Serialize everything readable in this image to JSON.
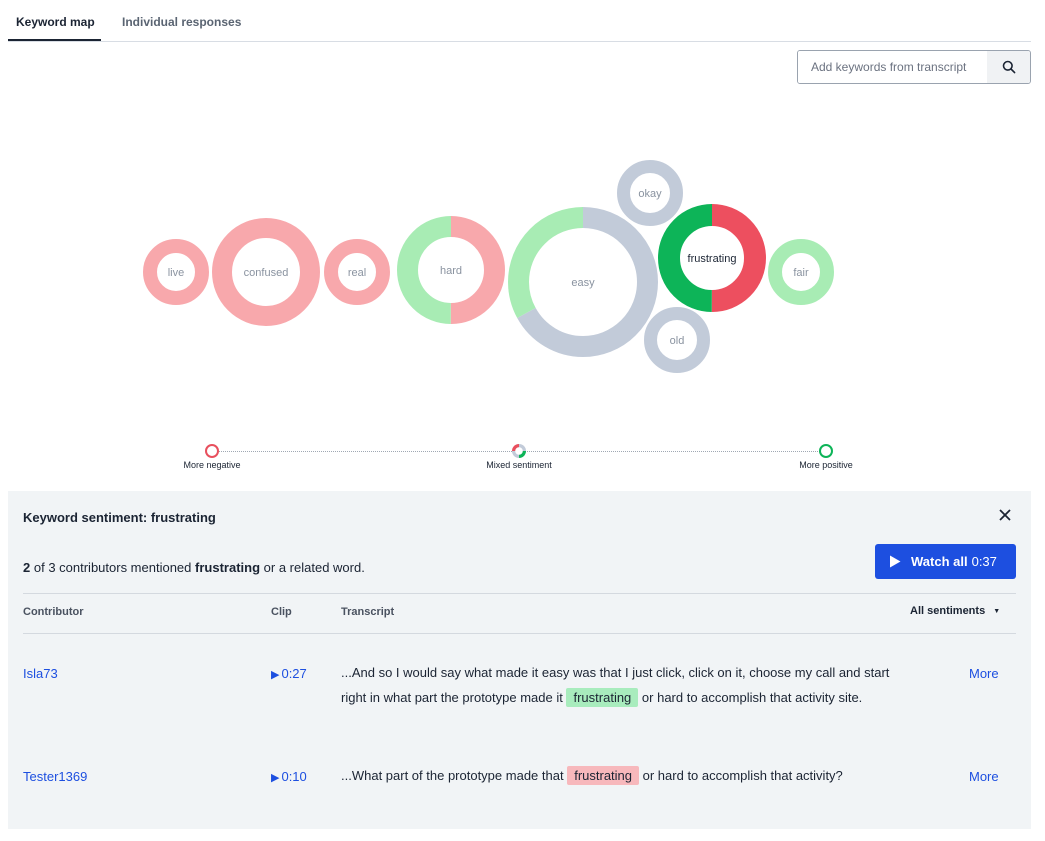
{
  "tabs": [
    {
      "label": "Keyword map",
      "active": true
    },
    {
      "label": "Individual responses",
      "active": false
    }
  ],
  "search": {
    "placeholder": "Add keywords from transcript",
    "icon": "search-icon"
  },
  "bubbles": [
    {
      "word": "live",
      "segments": [
        {
          "color": "#f8a8ac",
          "frac": 1
        }
      ]
    },
    {
      "word": "confused",
      "segments": [
        {
          "color": "#f8a8ac",
          "frac": 1
        }
      ]
    },
    {
      "word": "real",
      "segments": [
        {
          "color": "#f8a8ac",
          "frac": 1
        }
      ]
    },
    {
      "word": "hard",
      "segments": [
        {
          "color": "#f8a8ac",
          "frac": 0.5
        },
        {
          "color": "#a8ecb4",
          "frac": 0.5
        }
      ]
    },
    {
      "word": "easy",
      "segments": [
        {
          "color": "#c2cbd9",
          "frac": 0.67
        },
        {
          "color": "#a8ecb4",
          "frac": 0.33
        }
      ]
    },
    {
      "word": "okay",
      "segments": [
        {
          "color": "#c2cbd9",
          "frac": 1
        }
      ]
    },
    {
      "word": "old",
      "segments": [
        {
          "color": "#c2cbd9",
          "frac": 1
        }
      ]
    },
    {
      "word": "frustrating",
      "selected": true,
      "segments": [
        {
          "color": "#ed4f5f",
          "frac": 0.5
        },
        {
          "color": "#0db458",
          "frac": 0.5
        }
      ]
    },
    {
      "word": "fair",
      "segments": [
        {
          "color": "#a8ecb4",
          "frac": 1
        }
      ]
    }
  ],
  "scale": {
    "negative": {
      "label": "More negative",
      "color": "#e8505e"
    },
    "mixed": {
      "label": "Mixed sentiment"
    },
    "positive": {
      "label": "More positive",
      "color": "#0db458"
    }
  },
  "panel": {
    "title": "Keyword sentiment: frustrating",
    "summary": {
      "count": "2",
      "text_1": "of 3 contributors mentioned",
      "keyword": "frustrating",
      "text_2": "or a related word."
    },
    "watch_all": {
      "label": "Watch all",
      "duration": "0:37"
    },
    "columns": {
      "contributor": "Contributor",
      "clip": "Clip",
      "transcript": "Transcript"
    },
    "filter": "All sentiments",
    "rows": [
      {
        "contributor": "Isla73",
        "clip": "0:27",
        "before": "...And so I would say what made it easy was that I just click, click on it, choose my call and start right in what part the prototype made it",
        "keyword": "frustrating",
        "sentiment": "positive",
        "after": "or hard to accomplish that activity site.",
        "more": "More"
      },
      {
        "contributor": "Tester1369",
        "clip": "0:10",
        "before": "...What part of the prototype made that",
        "keyword": "frustrating",
        "sentiment": "negative",
        "after": "or hard to accomplish that activity?",
        "more": "More"
      }
    ]
  }
}
